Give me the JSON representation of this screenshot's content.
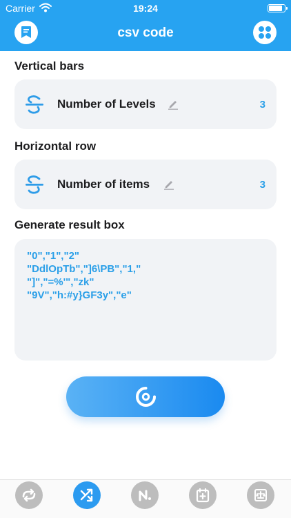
{
  "status_bar": {
    "carrier": "Carrier",
    "time": "19:24"
  },
  "header": {
    "title": "csv code"
  },
  "vertical": {
    "section_title": "Vertical bars",
    "label": "Number of Levels",
    "value": "3"
  },
  "horizontal": {
    "section_title": "Horizontal row",
    "label": "Number of items",
    "value": "3"
  },
  "result": {
    "section_title": "Generate result box",
    "text": "\"0\",\"1\",\"2\"\n\"DdlOpTb\",\"]6\\PB\",\"1,\"\n\"]\",\"=%'\",\"zk\"\n\"9V\",\"h:#y}GF3y\",\"e\""
  },
  "colors": {
    "accent": "#27a3f1",
    "value_text": "#2a9fe8",
    "card_bg": "#f1f3f6",
    "tab_inactive": "#bdbdbd"
  },
  "tabs": [
    {
      "icon": "loop-icon",
      "active": false
    },
    {
      "icon": "shuffle-icon",
      "active": true
    },
    {
      "icon": "n-letter-icon",
      "active": false
    },
    {
      "icon": "calendar-add-icon",
      "active": false
    },
    {
      "icon": "scale-icon",
      "active": false
    }
  ]
}
